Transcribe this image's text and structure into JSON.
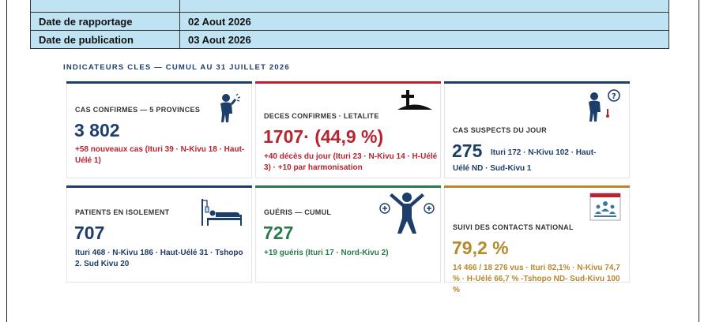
{
  "meta_table": [
    {
      "label": "Date de rapportage",
      "value": "02 Aout 2026"
    },
    {
      "label": "Date de publication",
      "value": "03 Aout 2026"
    }
  ],
  "section_title": "INDICATEURS CLES — CUMUL AU 31 JUILLET 2026",
  "cards": {
    "confirmes": {
      "label": "CAS CONFIRMES — 5 PROVINCES",
      "value": "3 802",
      "sub": "+58 nouveaux cas (Ituri 39 · N-Kivu 18 · Haut-Uélé 1)",
      "icon": "person-coughing-icon"
    },
    "deces": {
      "label": "DECES CONFIRMES · LETALITE",
      "value": "1707· (44,9 %)",
      "sub": "+40 décès du jour (Ituri 23 · N-Kivu 14 · H-Uélé 3) · +10 par harmonisation",
      "icon": "grave-cross-icon"
    },
    "suspects": {
      "label": "CAS SUSPECTS DU JOUR",
      "value": "275",
      "inline": "Ituri 172 · N-Kivu 102 · Haut-",
      "sub": "Uélé ND · Sud-Kivu 1",
      "icon": "person-question-icon"
    },
    "isolement": {
      "label": "PATIENTS EN ISOLEMENT",
      "value": "707",
      "sub": "Ituri 468 · N-Kivu 186 · Haut-Uélé 31 · Tshopo 2. Sud Kivu 20",
      "icon": "hospital-bed-icon"
    },
    "gueris": {
      "label": "GUÉRIS — CUMUL",
      "value": "727",
      "sub": "+19 guéris (Ituri 17 · Nord-Kivu 2)",
      "icon": "person-recovered-icon"
    },
    "contacts": {
      "label": "SUIVI DES CONTACTS NATIONAL",
      "value": "79,2 %",
      "sub": "14 466 / 18 276 vus · Ituri 82,1% · N-Kivu 74,7 % · H-Uélé 66,7 % -Tshopo ND- Sud-Kivu 100 %",
      "icon": "contacts-group-icon"
    }
  },
  "colors": {
    "navy": "#1d3d6b",
    "red": "#b8232f",
    "green": "#2a7a4b",
    "gold": "#b5892c",
    "table_bg": "#bfe3f3"
  }
}
